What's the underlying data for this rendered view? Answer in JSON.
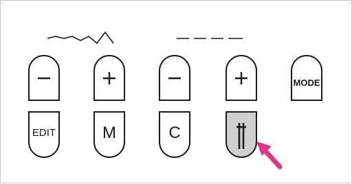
{
  "colors": {
    "outline": "#1a1a1a",
    "active_fill": "#cfcfcf",
    "pointer": "#e0338a",
    "frame": "#c8c8c8"
  },
  "indicators": {
    "left": "wave-pattern-icon",
    "right": "straight-dashed-line-icon"
  },
  "buttons": {
    "stitch_width_minus": {
      "icon": "minus-icon"
    },
    "stitch_width_plus": {
      "icon": "plus-icon"
    },
    "stitch_length_minus": {
      "icon": "minus-icon"
    },
    "stitch_length_plus": {
      "icon": "plus-icon"
    },
    "mode": {
      "label": "MODE"
    },
    "edit": {
      "label": "EDIT"
    },
    "memory": {
      "label": "M"
    },
    "clear": {
      "label": "C"
    },
    "twin_needle": {
      "icon": "twin-needle-icon",
      "state": "pressed"
    }
  },
  "pointer": {
    "icon": "pointer-arrow-icon",
    "target": "twin_needle"
  }
}
